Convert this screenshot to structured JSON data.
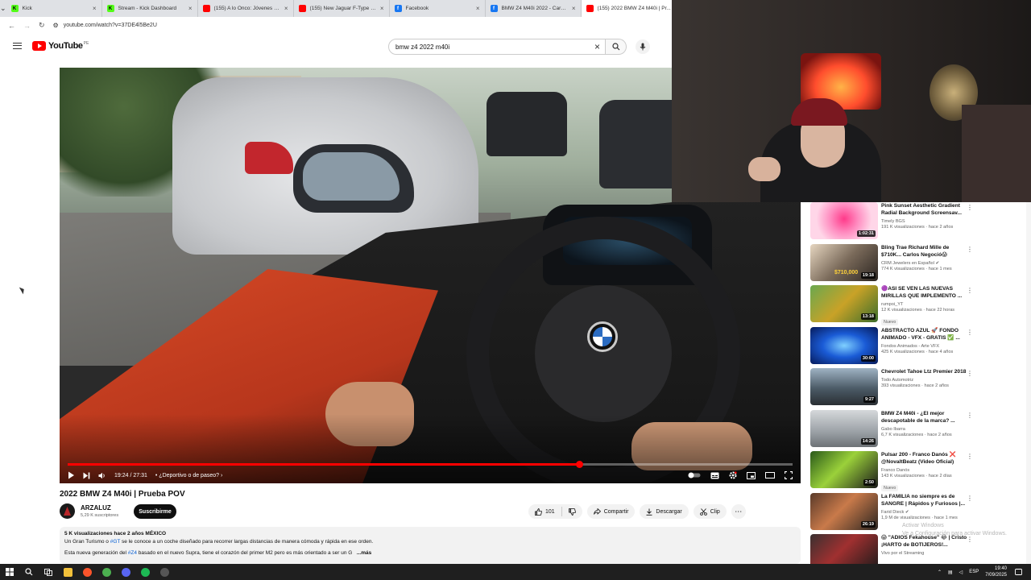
{
  "browser": {
    "tabs": [
      {
        "title": "Kick",
        "favicon_color": "#53fc18",
        "favicon_letter": "K",
        "active": false
      },
      {
        "title": "Stream - Kick Dashboard",
        "favicon_color": "#53fc18",
        "favicon_letter": "K",
        "active": false
      },
      {
        "title": "(155) A lo Onco: Jóvenes causa...",
        "favicon_color": "#ff0000",
        "favicon_letter": "",
        "active": false
      },
      {
        "title": "(155) New Jaguar F-Type R (F...",
        "favicon_color": "#ff0000",
        "favicon_letter": "",
        "active": false
      },
      {
        "title": "Facebook",
        "favicon_color": "#1877f2",
        "favicon_letter": "f",
        "active": false
      },
      {
        "title": "BMW Z4 M40i 2022 - Cars & Tr...",
        "favicon_color": "#1877f2",
        "favicon_letter": "f",
        "active": false
      },
      {
        "title": "(155) 2022 BMW Z4 M40i | Pr...",
        "favicon_color": "#ff0000",
        "favicon_letter": "",
        "active": true
      }
    ],
    "url": "youtube.com/watch?v=37DE4l5Be2U"
  },
  "youtube": {
    "logo_text": "YouTube",
    "region": "PE",
    "search_value": "bmw z4 2022 m40i"
  },
  "player": {
    "time_current": "19:24",
    "time_total": "27:31",
    "time_separator": " / ",
    "chapter": "• ¿Deportivo o de paseo? ›",
    "progress_fraction": 0.7051
  },
  "video": {
    "title": "2022 BMW Z4 M40i | Prueba POV",
    "channel": "ARZALUZ",
    "subscribers": "5,29 K suscriptores",
    "subscribe_label": "Suscribirme",
    "likes": "101",
    "share_label": "Compartir",
    "download_label": "Descargar",
    "clip_label": "Clip",
    "description": {
      "stats": "5 K visualizaciones  hace 2 años  MÉXICO",
      "line1_before": "Un Gran Turismo o ",
      "line1_tag": "#GT",
      "line1_after": " se le conoce a un coche diseñado para recorrer largas distancias de manera cómoda y rápida en ese orden.",
      "line2_before": "Esta nueva generación del ",
      "line2_tag": "#Z4",
      "line2_after": " basado en el nuevo Supra, tiene el corazón del primer M2 pero es más orientado a ser un G",
      "more_label": "...más"
    }
  },
  "recommendations": [
    {
      "title": "Pink Sunset Aesthetic Gradient Radial Background Screensav...",
      "channel": "Timely BGS",
      "stats": "191 K visualizaciones · hace 2 años",
      "duration": "1:02:31",
      "verified": false,
      "badge": "",
      "thumb": "pink"
    },
    {
      "title": "Bling Trae Richard Mille de $710K... Carlos Negoció😱",
      "channel": "CRM Jewelers en Español",
      "stats": "774 K visualizaciones · hace 1 mes",
      "duration": "19:18",
      "verified": true,
      "badge": "",
      "thumb": "bling",
      "thumb_text": "$710,000"
    },
    {
      "title": "🟣ASI SE VEN LAS NUEVAS MIRILLAS QUE IMPLEMENTO ...",
      "channel": "rumpoi_YT",
      "stats": "12 K visualizaciones · hace 22 horas",
      "duration": "13:18",
      "verified": false,
      "badge": "Nuevo",
      "thumb": "game"
    },
    {
      "title": "ABSTRACTO AZUL 🚀 FONDO ANIMADO - VFX - GRATIS ✅ ...",
      "channel": "Fondos Animados - Arte VFX",
      "stats": "425 K visualizaciones · hace 4 años",
      "duration": "30:00",
      "verified": false,
      "badge": "",
      "thumb": "blue"
    },
    {
      "title": "Chevrolet Tahoe Ltz Premier 2018",
      "channel": "Todo Automotriz",
      "stats": "393 visualizaciones · hace 2 años",
      "duration": "9:27",
      "verified": false,
      "badge": "",
      "thumb": "tahoe"
    },
    {
      "title": "BMW Z4 M40i - ¿El mejor descapotable de la marca? ...",
      "channel": "Gabo Ibarra",
      "stats": "6,7 K visualizaciones · hace 2 años",
      "duration": "14:26",
      "verified": false,
      "badge": "",
      "thumb": "z4"
    },
    {
      "title": "Pulsar 200 - Franco Danós ❌ @NovaltBeatz (Video Oficial)",
      "channel": "Franco Danós",
      "stats": "143 K visualizaciones · hace 2 días",
      "duration": "2:50",
      "verified": false,
      "badge": "Nuevo",
      "thumb": "pulsar"
    },
    {
      "title": "La FAMILIA no siempre es de SANGRE | Rápidos y Furiosos |...",
      "channel": "Farid Dieck",
      "stats": "1,9 M de visualizaciones · hace 1 mes",
      "duration": "26:19",
      "verified": true,
      "badge": "",
      "thumb": "family"
    },
    {
      "title": "😱 \"ADIOS Fekahouse\" 😂 | Cristo ¡HARTO de BOTIJEROS!...",
      "channel": "Vivo por el Streaming",
      "stats": "",
      "duration": "",
      "verified": false,
      "badge": "",
      "thumb": "adios"
    }
  ],
  "watermark": {
    "line1": "Activar Windows",
    "line2": "Ve a Configuración para activar Windows."
  },
  "taskbar": {
    "apps": [
      {
        "name": "file-explorer",
        "color": "#f3c13a"
      },
      {
        "name": "brave",
        "color": "#fb542b"
      },
      {
        "name": "chrome",
        "color": "#4caf50"
      },
      {
        "name": "discord",
        "color": "#5865f2"
      },
      {
        "name": "spotify",
        "color": "#1db954"
      },
      {
        "name": "obs",
        "color": "#555555"
      }
    ],
    "language": "ESP",
    "time": "19:40",
    "date": "7/09/2025"
  },
  "colors": {
    "accent_red": "#ff0000",
    "link_blue": "#065fd4",
    "progress_red": "#ff0000"
  }
}
